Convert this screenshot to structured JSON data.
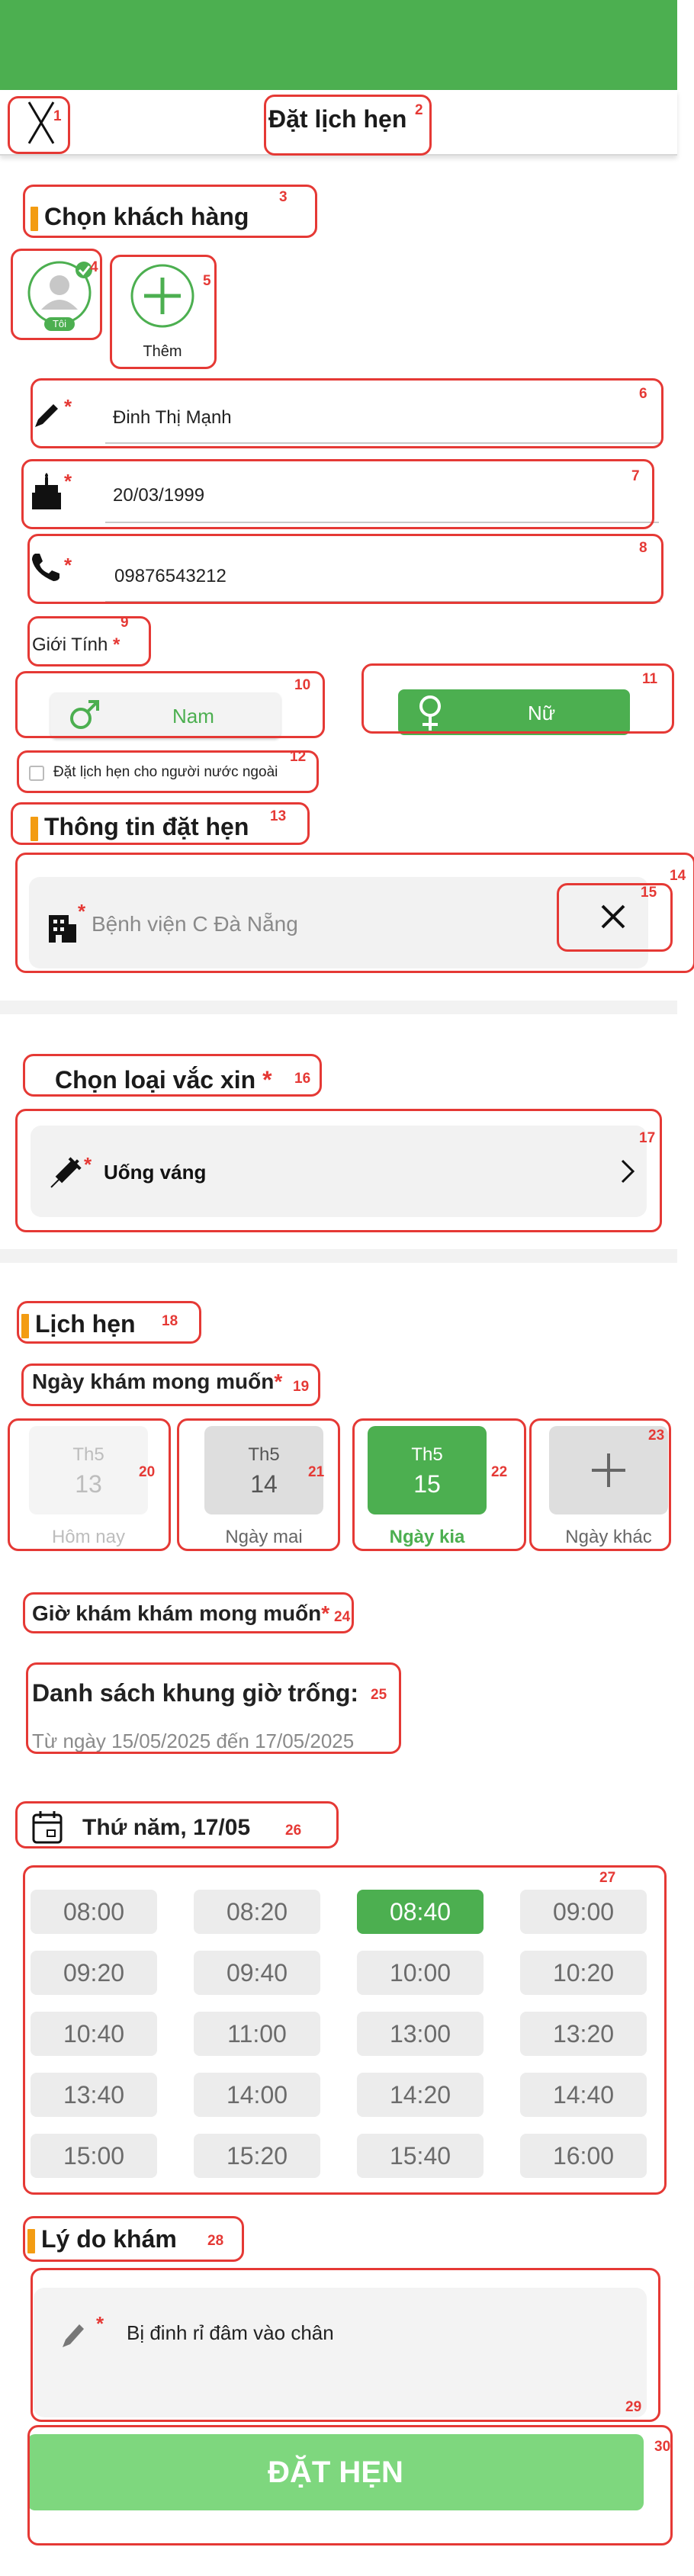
{
  "header": {
    "title": "Đặt lịch hẹn",
    "color": "#4caf50"
  },
  "customer": {
    "title": "Chọn khách hàng",
    "self_badge": "Tôi",
    "add_label": "Thêm"
  },
  "form": {
    "name": "Đinh Thị Mạnh",
    "dob": "20/03/1999",
    "phone": "09876543212",
    "gender_label": "Giới Tính",
    "gender_male": "Nam",
    "gender_female": "Nữ",
    "foreigner_label": "Đặt lịch hẹn cho người nước ngoài"
  },
  "booking_info": {
    "title": "Thông tin đặt hẹn",
    "hospital_placeholder": "Bệnh viện C Đà Nẵng"
  },
  "vaccine": {
    "title": "Chọn loại vắc xin",
    "value": "Uống váng"
  },
  "schedule": {
    "title": "Lịch hẹn",
    "date_label": "Ngày khám mong muốn",
    "dates": [
      {
        "month": "Th5",
        "day": "13",
        "label": "Hôm nay"
      },
      {
        "month": "Th5",
        "day": "14",
        "label": "Ngày mai"
      },
      {
        "month": "Th5",
        "day": "15",
        "label": "Ngày kia"
      }
    ],
    "other_date_label": "Ngày khác",
    "time_label": "Giờ khám khám mong muốn",
    "free_slots_title": "Danh sách khung giờ trống:",
    "free_slots_range": "Từ ngày 15/05/2025 đến 17/05/2025",
    "day_heading": "Thứ năm, 17/05",
    "slots": [
      "08:00",
      "08:20",
      "08:40",
      "09:00",
      "09:20",
      "09:40",
      "10:00",
      "10:20",
      "10:40",
      "11:00",
      "13:00",
      "13:20",
      "13:40",
      "14:00",
      "14:20",
      "14:40",
      "15:00",
      "15:20",
      "15:40",
      "16:00"
    ],
    "selected_slot": "08:40"
  },
  "reason": {
    "title": "Lý do khám",
    "text": "Bị đinh rỉ đâm vào chân"
  },
  "submit_label": "ĐẶT HẸN",
  "annotations": [
    "1",
    "2",
    "3",
    "4",
    "5",
    "6",
    "7",
    "8",
    "9",
    "10",
    "11",
    "12",
    "13",
    "14",
    "15",
    "16",
    "17",
    "18",
    "19",
    "20",
    "21",
    "22",
    "23",
    "24",
    "25",
    "26",
    "27",
    "28",
    "29",
    "30"
  ]
}
